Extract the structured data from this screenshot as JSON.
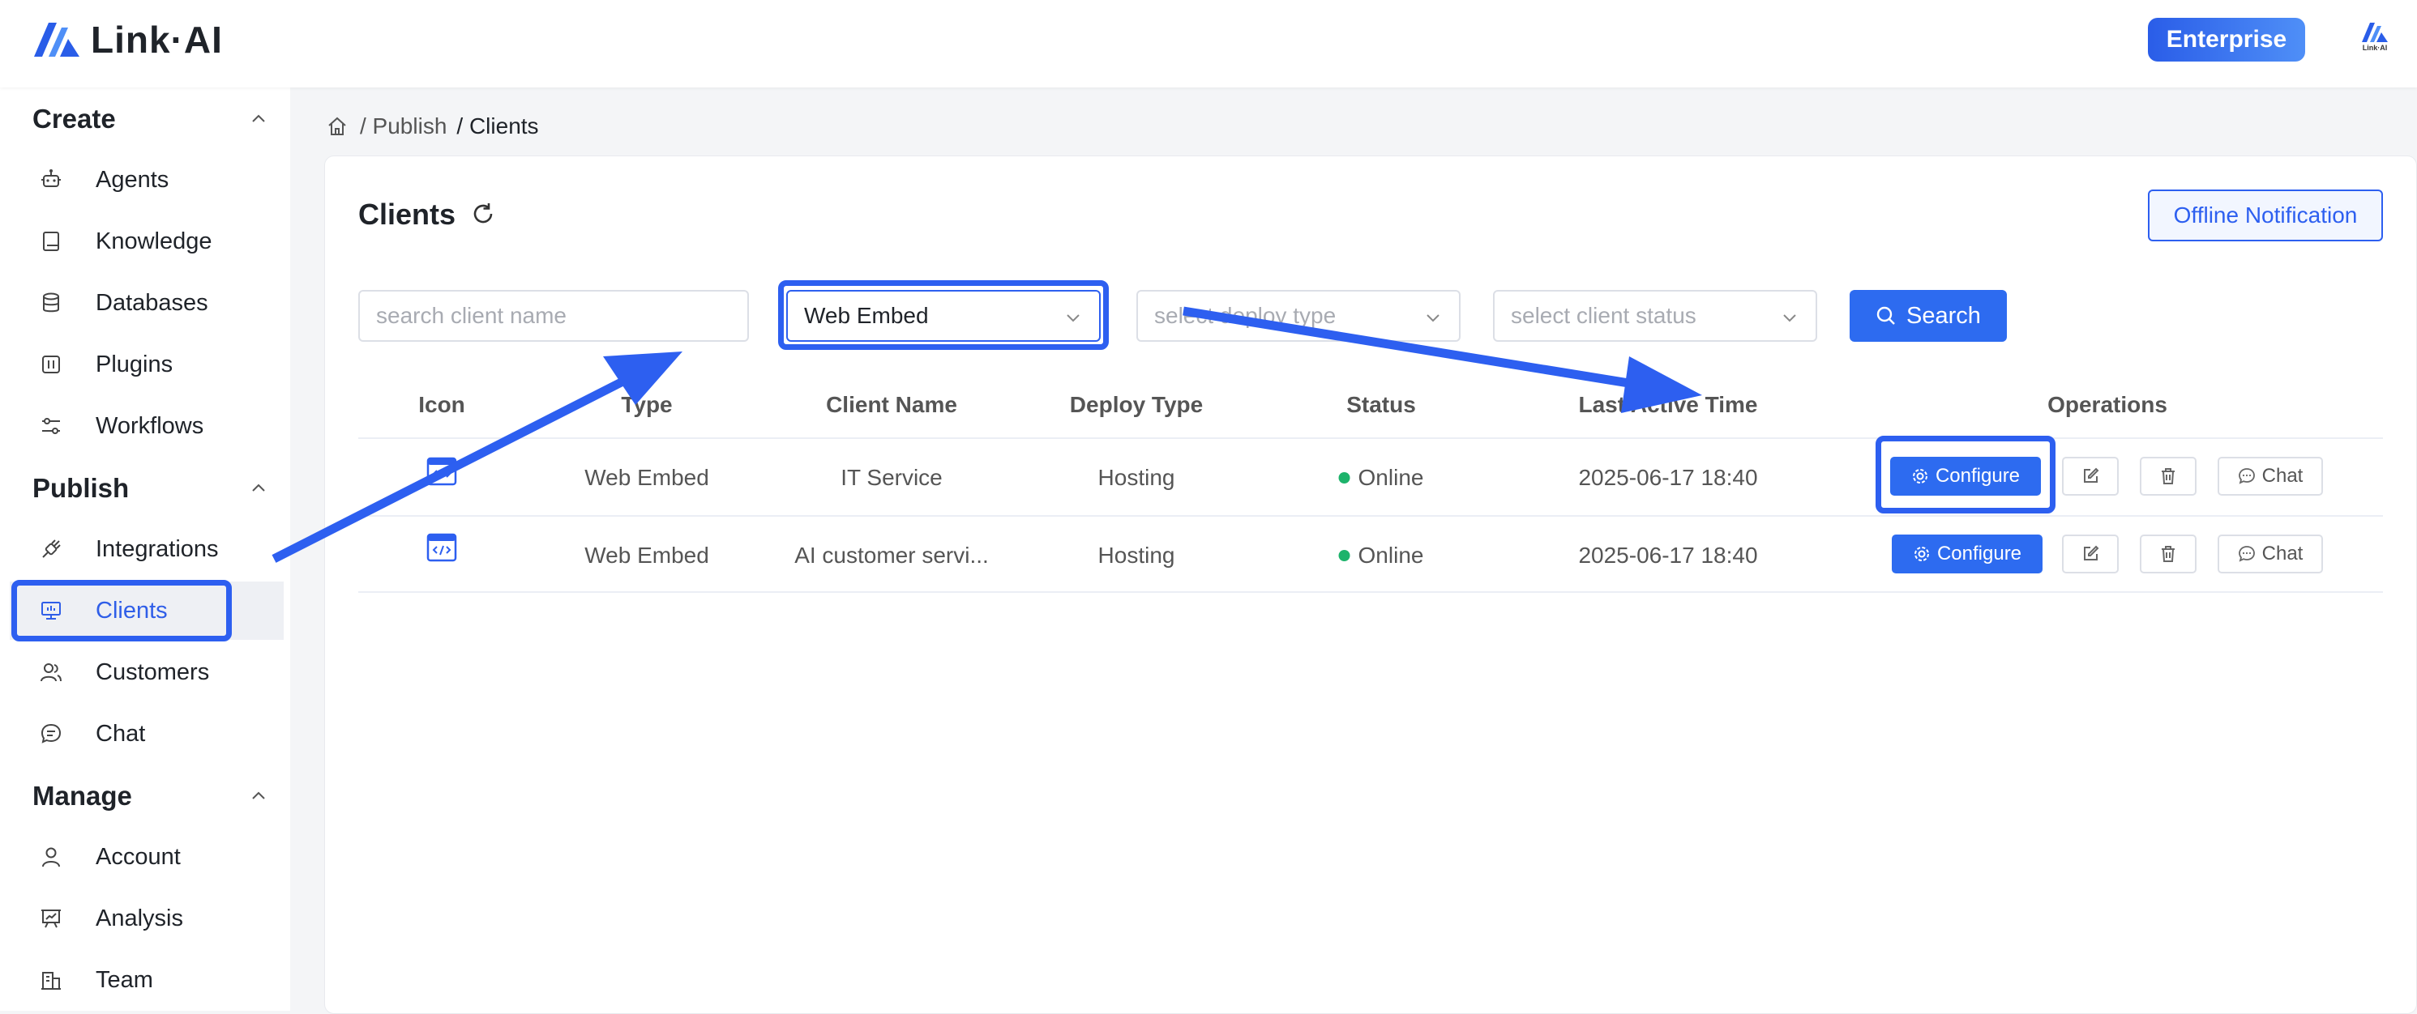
{
  "header": {
    "logo_text": "Link·AI",
    "enterprise_label": "Enterprise",
    "avatar_text": "Link·AI"
  },
  "sidebar": {
    "sections": [
      {
        "title": "Create",
        "items": [
          "Agents",
          "Knowledge",
          "Databases",
          "Plugins",
          "Workflows"
        ]
      },
      {
        "title": "Publish",
        "items": [
          "Integrations",
          "Clients",
          "Customers",
          "Chat"
        ]
      },
      {
        "title": "Manage",
        "items": [
          "Account",
          "Analysis",
          "Team"
        ]
      }
    ],
    "active_item": "Clients"
  },
  "breadcrumb": {
    "sep1": "/ Publish",
    "sep2": "/ Clients"
  },
  "page": {
    "title": "Clients",
    "offline_notification_label": "Offline Notification"
  },
  "filters": {
    "client_name_placeholder": "search client name",
    "type_value": "Web Embed",
    "deploy_type_placeholder": "select deploy type",
    "client_status_placeholder": "select client status",
    "search_label": "Search"
  },
  "table": {
    "columns": [
      "Icon",
      "Type",
      "Client Name",
      "Deploy Type",
      "Status",
      "Last Active Time",
      "Operations"
    ],
    "rows": [
      {
        "type": "Web Embed",
        "client_name": "IT Service",
        "deploy_type": "Hosting",
        "status": "Online",
        "last_active": "2025-06-17 18:40"
      },
      {
        "type": "Web Embed",
        "client_name": "AI customer servi...",
        "deploy_type": "Hosting",
        "status": "Online",
        "last_active": "2025-06-17 18:40"
      }
    ],
    "configure_label": "Configure",
    "chat_label": "Chat"
  },
  "colors": {
    "accent": "#2d6bf0",
    "highlight": "#2d5ff0",
    "online": "#1db36b"
  }
}
